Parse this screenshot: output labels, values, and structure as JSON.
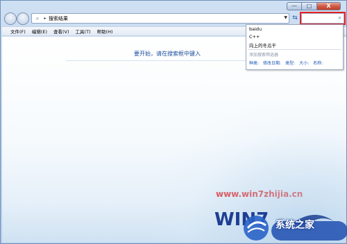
{
  "window": {
    "minimize": "—",
    "maximize": "□",
    "close": "X"
  },
  "address": {
    "path": "搜索结果"
  },
  "search": {
    "value": "",
    "placeholder": ""
  },
  "menu": {
    "items": [
      "文件(F)",
      "编辑(E)",
      "查看(V)",
      "工具(T)",
      "帮助(H)"
    ]
  },
  "content": {
    "hint": "要开始，请在搜索框中键入"
  },
  "search_dropdown": {
    "history": [
      "baidu",
      "C++",
      "向上的冬瓜干"
    ],
    "add_filter": "添加搜索筛选器",
    "filters": [
      "种类:",
      "修改日期:",
      "类型:",
      "大小:",
      "名称:"
    ]
  },
  "watermark": {
    "url": "www.win7zhijia.cn",
    "brand": "系统之家",
    "logo_text": "WIN7"
  },
  "colors": {
    "accent": "#1c4f9c",
    "highlight": "#e32222",
    "watermark_red": "#e02020"
  }
}
